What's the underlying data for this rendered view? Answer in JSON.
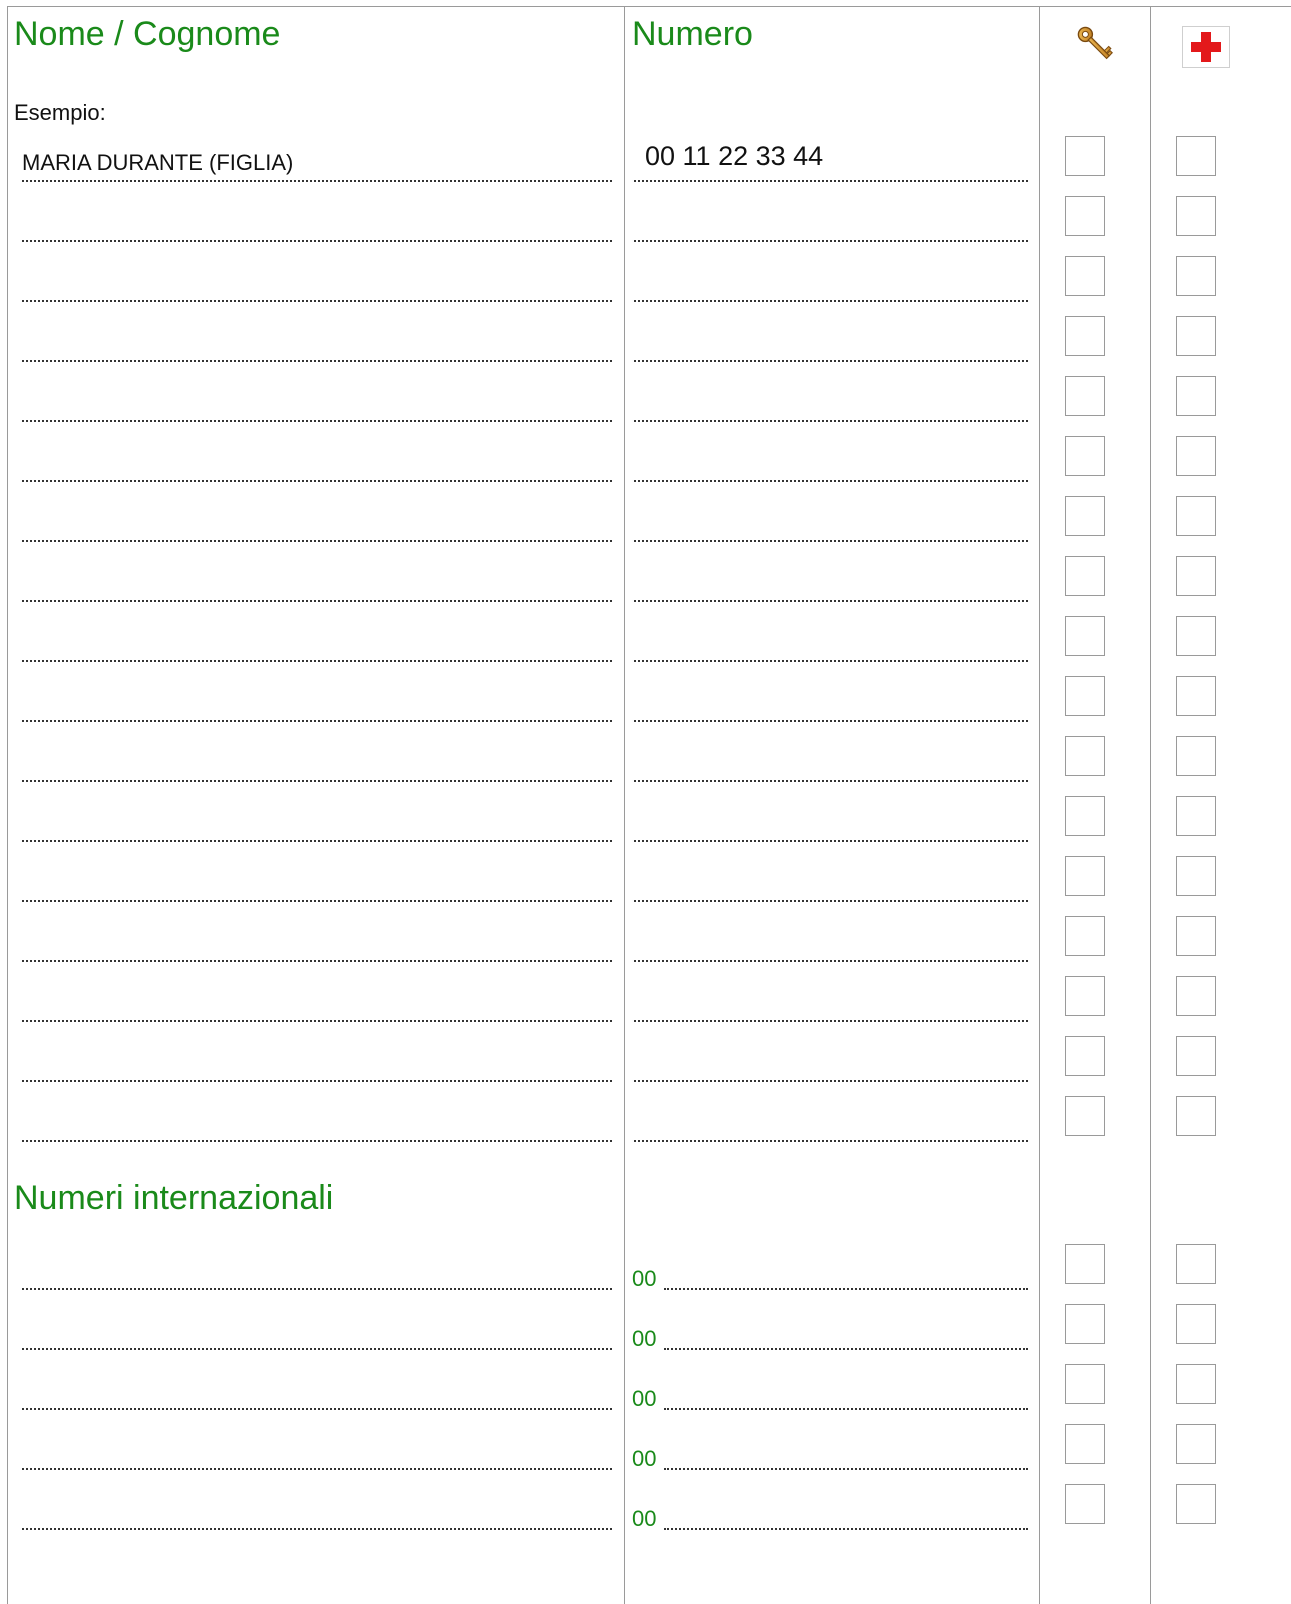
{
  "headers": {
    "name": "Nome / Cognome",
    "number": "Numero",
    "key_icon": "key-icon",
    "first_aid_icon": "red-cross-icon"
  },
  "example": {
    "label": "Esempio:",
    "name": "MARIA DURANTE (FIGLIA)",
    "number": "00 11 22 33 44"
  },
  "international": {
    "title": "Numeri internazionali",
    "prefix": "00"
  },
  "colors": {
    "heading": "#1a8a1a",
    "prefix": "#1a8a1a",
    "cross": "#e3191b",
    "key": "#c98a1e"
  }
}
